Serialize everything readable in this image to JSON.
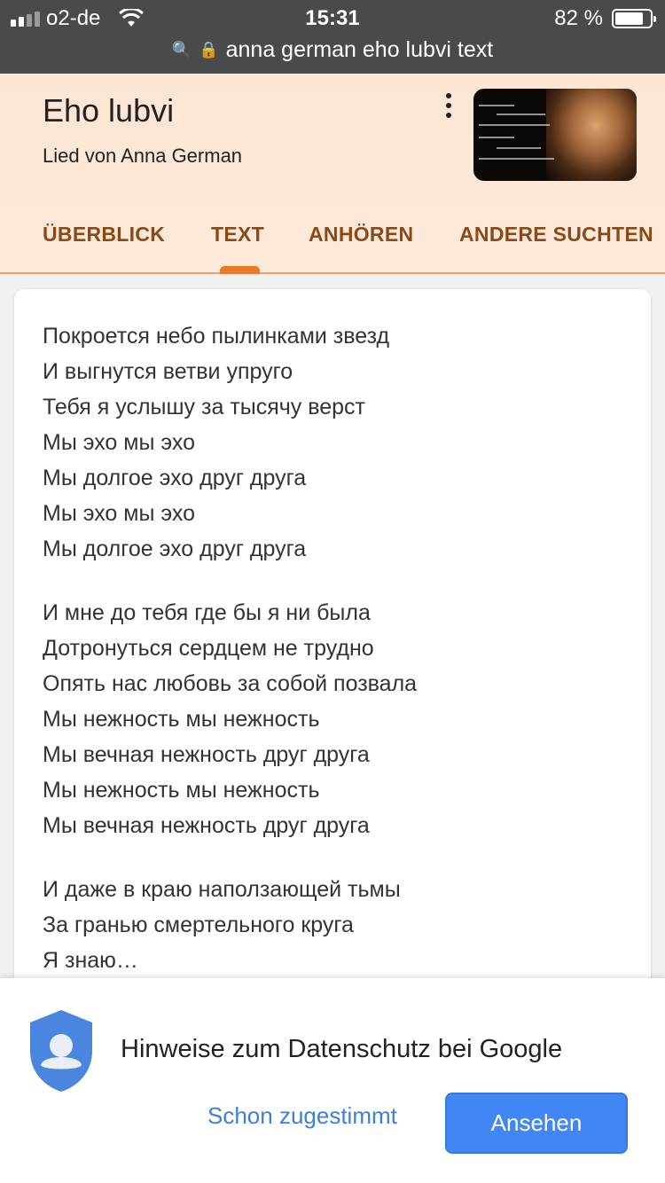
{
  "status_bar": {
    "carrier": "o2-de",
    "time": "15:31",
    "battery": "82 %",
    "battery_level": 0.82
  },
  "url_bar": {
    "query": "anna german eho lubvi text"
  },
  "song": {
    "title": "Eho lubvi",
    "subtitle": "Lied von Anna German"
  },
  "tabs": [
    {
      "label": "ÜBERBLICK"
    },
    {
      "label": "TEXT",
      "active": true
    },
    {
      "label": "ANHÖREN"
    },
    {
      "label": "ANDERE SUCHTEN"
    }
  ],
  "lyrics": [
    {
      "lines": [
        "Покроется небо пылинками звезд",
        "И выгнутся ветви упруго",
        "Тебя я услышу за тысячу верст",
        "Мы эхо мы эхо",
        "Мы долгое эхо друг друга",
        "Мы эхо мы эхо",
        "Мы долгое эхо друг друга"
      ]
    },
    {
      "lines": [
        "И мне до тебя где бы я ни была",
        "Дотронуться сердцем не трудно",
        "Опять нас любовь за собой позвала",
        "Мы нежность мы нежность",
        "Мы вечная нежность друг друга",
        "Мы нежность мы нежность",
        "Мы вечная нежность друг друга"
      ]
    },
    {
      "lines": [
        "И даже в краю наползающей тьмы",
        "За гранью смертельного круга",
        "Я знаю…"
      ]
    }
  ],
  "privacy": {
    "title": "Hinweise zum Datenschutz bei Google",
    "secondary_label": "Schon zugestimmt",
    "primary_label": "Ansehen"
  },
  "colors": {
    "accent": "#e87a2c",
    "tab_text": "#8a4a18",
    "primary_button": "#4285f4",
    "link": "#3d7ee0"
  }
}
